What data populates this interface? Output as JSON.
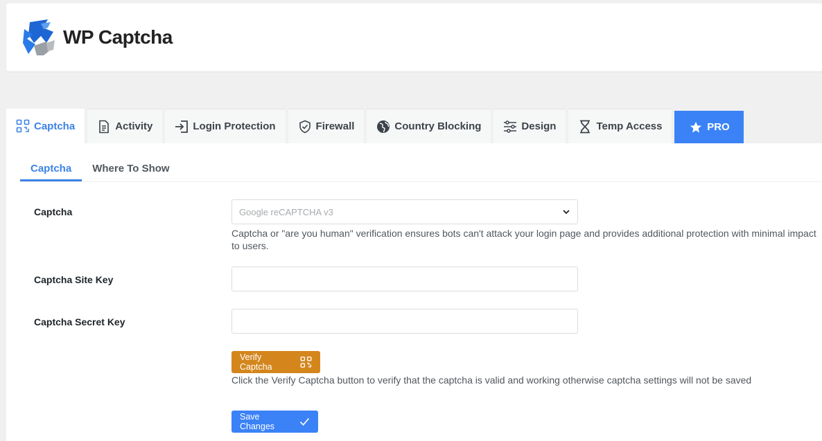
{
  "brand": {
    "name": "WP Captcha"
  },
  "tabs": [
    {
      "label": "Captcha",
      "icon": "captcha-icon",
      "active": true
    },
    {
      "label": "Activity",
      "icon": "document-icon"
    },
    {
      "label": "Login Protection",
      "icon": "login-icon"
    },
    {
      "label": "Firewall",
      "icon": "shield-icon"
    },
    {
      "label": "Country Blocking",
      "icon": "globe-icon"
    },
    {
      "label": "Design",
      "icon": "sliders-icon"
    },
    {
      "label": "Temp Access",
      "icon": "hourglass-icon"
    },
    {
      "label": "PRO",
      "icon": "star-icon"
    }
  ],
  "subtabs": [
    {
      "label": "Captcha",
      "active": true
    },
    {
      "label": "Where To Show"
    }
  ],
  "form": {
    "captcha_label": "Captcha",
    "captcha_select_value": "Google reCAPTCHA v3",
    "captcha_desc": "Captcha or \"are you human\" verification ensures bots can't attack your login page and provides additional protection with minimal impact to users.",
    "site_key_label": "Captcha Site Key",
    "site_key_value": "",
    "secret_key_label": "Captcha Secret Key",
    "secret_key_value": "",
    "verify_button": "Verify Captcha",
    "verify_desc": "Click the Verify Captcha button to verify that the captcha is valid and working otherwise captcha settings will not be saved",
    "save_button": "Save Changes"
  },
  "colors": {
    "accent": "#3b82f6",
    "verify": "#d4861d"
  }
}
